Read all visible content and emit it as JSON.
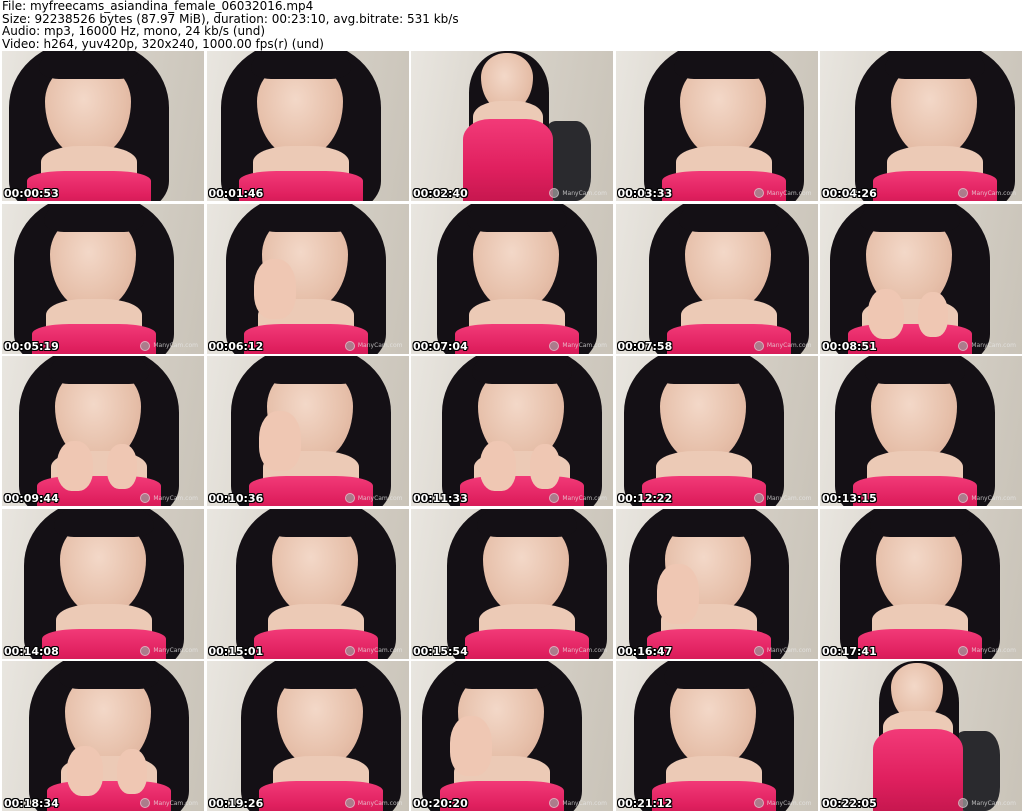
{
  "header": {
    "file_line": "File: myfreecams_asiandina_female_06032016.mp4",
    "size_line": "Size: 92238526 bytes (87.97 MiB), duration: 00:23:10, avg.bitrate: 531 kb/s",
    "audio_line": "Audio: mp3, 16000 Hz, mono, 24 kb/s (und)",
    "video_line": "Video: h264, yuv420p, 320x240, 1000.00 fps(r) (und)"
  },
  "watermark": {
    "text": "ManyCam.com",
    "icon": "manycam-logo-icon"
  },
  "colors": {
    "top_pink": "#e0205f",
    "hair": "#141015",
    "wall": "#d8d3ca"
  },
  "thumbnails": [
    {
      "time": "00:00:53",
      "watermark": false,
      "pose": "close"
    },
    {
      "time": "00:01:46",
      "watermark": false,
      "pose": "close"
    },
    {
      "time": "00:02:40",
      "watermark": true,
      "pose": "far"
    },
    {
      "time": "00:03:33",
      "watermark": true,
      "pose": "close"
    },
    {
      "time": "00:04:26",
      "watermark": true,
      "pose": "close"
    },
    {
      "time": "00:05:19",
      "watermark": true,
      "pose": "close"
    },
    {
      "time": "00:06:12",
      "watermark": true,
      "pose": "hand"
    },
    {
      "time": "00:07:04",
      "watermark": true,
      "pose": "close"
    },
    {
      "time": "00:07:58",
      "watermark": true,
      "pose": "close"
    },
    {
      "time": "00:08:51",
      "watermark": true,
      "pose": "chin"
    },
    {
      "time": "00:09:44",
      "watermark": true,
      "pose": "chin"
    },
    {
      "time": "00:10:36",
      "watermark": true,
      "pose": "hand"
    },
    {
      "time": "00:11:33",
      "watermark": true,
      "pose": "chin"
    },
    {
      "time": "00:12:22",
      "watermark": true,
      "pose": "close"
    },
    {
      "time": "00:13:15",
      "watermark": true,
      "pose": "close"
    },
    {
      "time": "00:14:08",
      "watermark": true,
      "pose": "close"
    },
    {
      "time": "00:15:01",
      "watermark": true,
      "pose": "close"
    },
    {
      "time": "00:15:54",
      "watermark": true,
      "pose": "close"
    },
    {
      "time": "00:16:47",
      "watermark": true,
      "pose": "hand"
    },
    {
      "time": "00:17:41",
      "watermark": true,
      "pose": "close"
    },
    {
      "time": "00:18:34",
      "watermark": true,
      "pose": "chin"
    },
    {
      "time": "00:19:26",
      "watermark": true,
      "pose": "close"
    },
    {
      "time": "00:20:20",
      "watermark": true,
      "pose": "hand"
    },
    {
      "time": "00:21:12",
      "watermark": true,
      "pose": "close"
    },
    {
      "time": "00:22:05",
      "watermark": true,
      "pose": "far"
    }
  ]
}
